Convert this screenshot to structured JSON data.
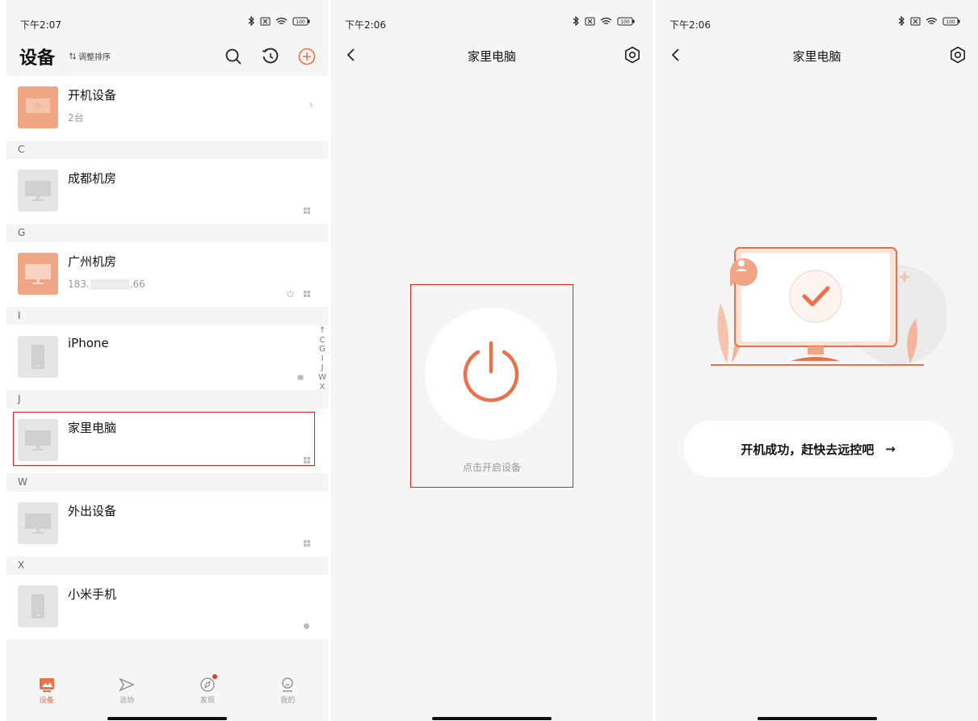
{
  "panel_devices": {
    "status_time": "下午2:07",
    "title": "设备",
    "sort_label": "调整排序",
    "sections": [
      {
        "rows": [
          {
            "name": "开机设备",
            "sub": "2台",
            "thumb": "orange",
            "kind": "power"
          }
        ]
      },
      {
        "letter": "C",
        "rows": [
          {
            "name": "成都机房",
            "sub": "",
            "thumb": "gray",
            "kind": "monitor"
          }
        ]
      },
      {
        "letter": "G",
        "rows": [
          {
            "name": "广州机房",
            "sub_prefix": "183.",
            "sub_suffix": ".66",
            "thumb": "orange",
            "kind": "monitor"
          }
        ]
      },
      {
        "letter": "I",
        "rows": [
          {
            "name": "iPhone",
            "sub": "",
            "thumb": "gray",
            "kind": "phone"
          }
        ]
      },
      {
        "letter": "J",
        "rows": [
          {
            "name": "家里电脑",
            "sub": "",
            "thumb": "gray",
            "kind": "monitor"
          }
        ]
      },
      {
        "letter": "W",
        "rows": [
          {
            "name": "外出设备",
            "sub": "",
            "thumb": "gray",
            "kind": "monitor"
          }
        ]
      },
      {
        "letter": "X",
        "rows": [
          {
            "name": "小米手机",
            "sub": "",
            "thumb": "gray",
            "kind": "phone"
          }
        ]
      }
    ],
    "alpha_index": [
      "↑",
      "C",
      "G",
      "I",
      "J",
      "W",
      "X"
    ],
    "tabs": [
      {
        "label": "设备",
        "icon": "devices-icon",
        "active": true
      },
      {
        "label": "远协",
        "icon": "remote-assist-icon",
        "active": false
      },
      {
        "label": "发现",
        "icon": "compass-icon",
        "active": false,
        "badge": true
      },
      {
        "label": "我的",
        "icon": "profile-icon",
        "active": false
      }
    ]
  },
  "panel_power": {
    "status_time": "下午2:06",
    "title": "家里电脑",
    "hint": "点击开启设备"
  },
  "panel_success": {
    "status_time": "下午2:06",
    "title": "家里电脑",
    "cta_label": "开机成功，赶快去远控吧",
    "cta_arrow": "→"
  },
  "colors": {
    "accent": "#e8734a",
    "accent_light": "#f0a585",
    "highlight_box": "#d9251d",
    "background": "#f5f5f5"
  }
}
